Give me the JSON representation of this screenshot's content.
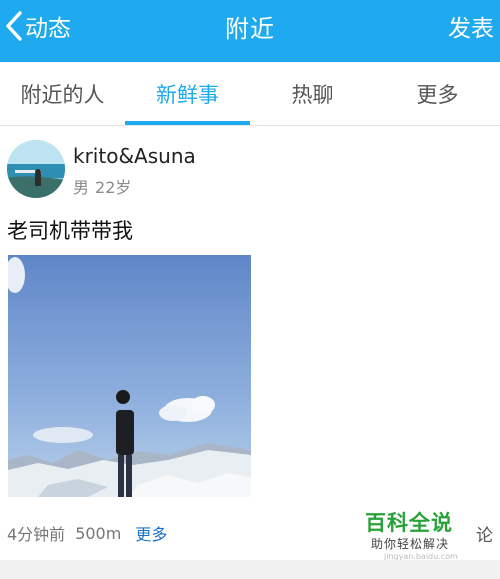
{
  "header": {
    "back_label": "动态",
    "title": "附近",
    "action_label": "发表",
    "bg_color": "#1fa9ee"
  },
  "tabs": [
    {
      "label": "附近的人",
      "active": false
    },
    {
      "label": "新鲜事",
      "active": true
    },
    {
      "label": "热聊",
      "active": false
    },
    {
      "label": "更多",
      "active": false
    }
  ],
  "post": {
    "username": "krito&Asuna",
    "gender": "男",
    "age": "22岁",
    "text": "老司机带带我",
    "time": "4分钟前",
    "distance": "500m",
    "more_label": "更多",
    "comment_label": "论"
  },
  "watermark": {
    "title": "百科全说",
    "subtitle": "助你轻松解决",
    "url": "jingyan.baidu.com"
  },
  "icons": [
    "chevron-left-icon"
  ]
}
